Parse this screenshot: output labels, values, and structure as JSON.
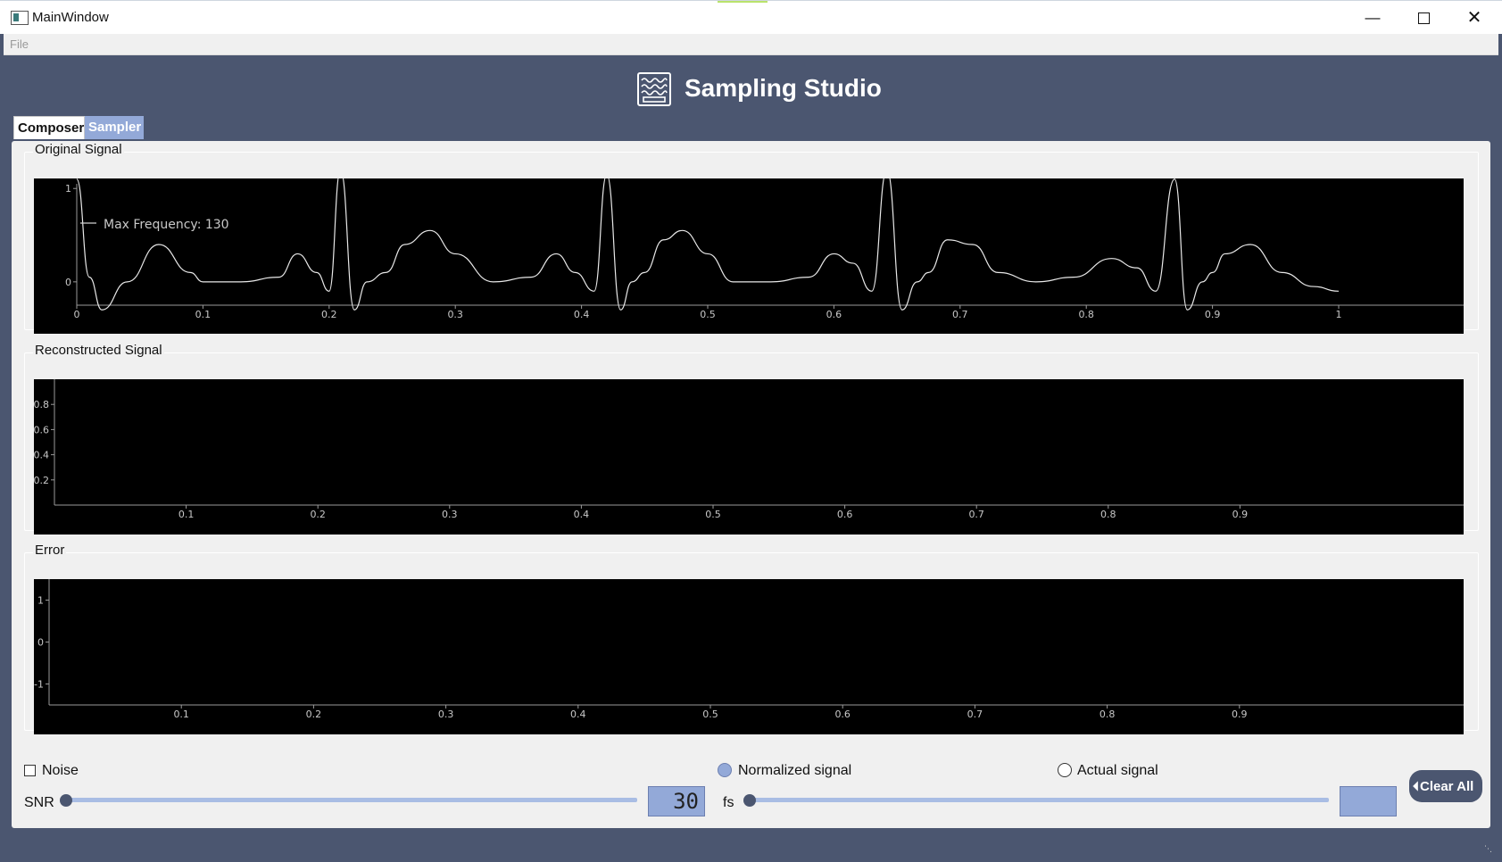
{
  "window": {
    "title": "MainWindow",
    "controls": {
      "minimize": "—",
      "close": "✕"
    }
  },
  "menu": {
    "file": "File"
  },
  "app": {
    "title": "Sampling Studio",
    "logo_icon": "waveform-icon"
  },
  "tabs": [
    {
      "label": "Composer",
      "active": true
    },
    {
      "label": "Sampler",
      "active": false
    }
  ],
  "groups": {
    "original": "Original Signal",
    "reconstructed": "Reconstructed Signal",
    "error": "Error"
  },
  "controls": {
    "noise_label": "Noise",
    "noise_checked": false,
    "normalized_label": "Normalized signal",
    "normalized_checked": true,
    "actual_label": "Actual signal",
    "actual_checked": false,
    "snr_label": "SNR",
    "snr_value": "30",
    "fs_label": "fs",
    "fs_value": "",
    "clear_label": "Clear All"
  },
  "chart_data": [
    {
      "type": "line",
      "title": "",
      "xlim": [
        0,
        1
      ],
      "ylim": [
        -0.25,
        1.05
      ],
      "x_ticks": [
        "0",
        "0.1",
        "0.2",
        "0.3",
        "0.4",
        "0.5",
        "0.6",
        "0.7",
        "0.8",
        "0.9",
        "1"
      ],
      "y_ticks": [
        "1",
        "0"
      ],
      "legend": "Max Frequency: 130",
      "series": [
        {
          "name": "Max Frequency: 130",
          "x": [
            0.0,
            0.01,
            0.02,
            0.04,
            0.065,
            0.09,
            0.1,
            0.13,
            0.16,
            0.175,
            0.19,
            0.2,
            0.209,
            0.22,
            0.23,
            0.245,
            0.26,
            0.28,
            0.3,
            0.33,
            0.36,
            0.38,
            0.395,
            0.41,
            0.42,
            0.431,
            0.44,
            0.45,
            0.465,
            0.48,
            0.5,
            0.52,
            0.55,
            0.58,
            0.6,
            0.615,
            0.63,
            0.642,
            0.654,
            0.666,
            0.675,
            0.69,
            0.71,
            0.73,
            0.76,
            0.79,
            0.82,
            0.84,
            0.855,
            0.87,
            0.88,
            0.892,
            0.9,
            0.91,
            0.93,
            0.955,
            0.98,
            1.0
          ],
          "y": [
            1.1,
            0.05,
            -0.3,
            0.0,
            0.4,
            0.1,
            0.0,
            0.0,
            0.05,
            0.3,
            0.1,
            -0.1,
            1.2,
            -0.3,
            0.0,
            0.1,
            0.4,
            0.55,
            0.3,
            0.0,
            0.05,
            0.3,
            0.1,
            -0.1,
            1.15,
            -0.3,
            0.0,
            0.1,
            0.45,
            0.55,
            0.3,
            0.0,
            0.0,
            0.05,
            0.3,
            0.2,
            -0.1,
            1.2,
            -0.3,
            0.0,
            0.1,
            0.45,
            0.4,
            0.1,
            0.0,
            0.05,
            0.25,
            0.15,
            -0.1,
            1.1,
            -0.3,
            0.0,
            0.1,
            0.3,
            0.4,
            0.1,
            -0.05,
            -0.1
          ]
        }
      ]
    },
    {
      "type": "line",
      "title": "",
      "xlim": [
        0,
        1
      ],
      "ylim": [
        0,
        1
      ],
      "x_ticks": [
        "0.1",
        "0.2",
        "0.3",
        "0.4",
        "0.5",
        "0.6",
        "0.7",
        "0.8",
        "0.9"
      ],
      "y_ticks": [
        "0.8",
        "0.6",
        "0.4",
        "0.2"
      ],
      "series": []
    },
    {
      "type": "line",
      "title": "",
      "xlim": [
        0,
        1
      ],
      "ylim": [
        -1.5,
        1.5
      ],
      "x_ticks": [
        "0.1",
        "0.2",
        "0.3",
        "0.4",
        "0.5",
        "0.6",
        "0.7",
        "0.8",
        "0.9"
      ],
      "y_ticks": [
        "1",
        "0",
        "-1"
      ],
      "series": []
    }
  ]
}
